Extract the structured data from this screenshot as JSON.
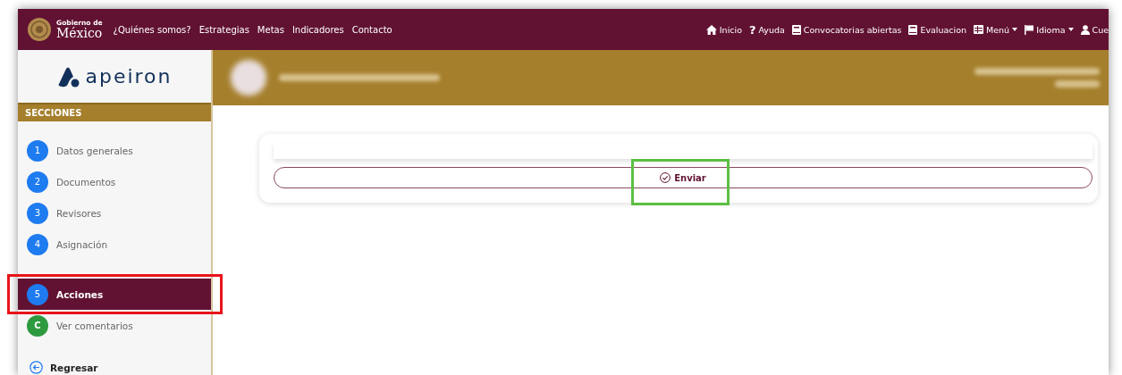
{
  "brand": {
    "small": "Gobierno de",
    "large": "México"
  },
  "nav_left": [
    "¿Quiénes somos?",
    "Estrategias",
    "Metas",
    "Indicadores",
    "Contacto"
  ],
  "nav_right": [
    {
      "label": "Inicio",
      "kind": "home",
      "dropdown": false
    },
    {
      "label": "Ayuda",
      "kind": "help",
      "symbol": "?",
      "dropdown": false
    },
    {
      "label": "Convocatorias abiertas",
      "kind": "book",
      "dropdown": false
    },
    {
      "label": "Evaluacion",
      "kind": "book",
      "dropdown": false
    },
    {
      "label": "Menú",
      "kind": "list",
      "dropdown": true
    },
    {
      "label": "Idioma",
      "kind": "flag",
      "dropdown": true
    },
    {
      "label": "Cue",
      "kind": "user",
      "dropdown": false
    }
  ],
  "sidebar": {
    "logo": "apeiron",
    "header": "SECCIONES",
    "steps": [
      {
        "badge": "1",
        "label": "Datos generales",
        "kind": "number",
        "selected": false
      },
      {
        "badge": "2",
        "label": "Documentos",
        "kind": "number",
        "selected": false
      },
      {
        "badge": "3",
        "label": "Revisores",
        "kind": "number",
        "selected": false
      },
      {
        "badge": "4",
        "label": "Asignación",
        "kind": "number",
        "selected": false
      },
      {
        "badge": "5",
        "label": "Acciones",
        "kind": "number",
        "selected": true
      },
      {
        "badge": "C",
        "label": "Ver comentarios",
        "kind": "comments",
        "selected": false
      }
    ],
    "back": "Regresar"
  },
  "actions": {
    "button": "Enviar"
  }
}
